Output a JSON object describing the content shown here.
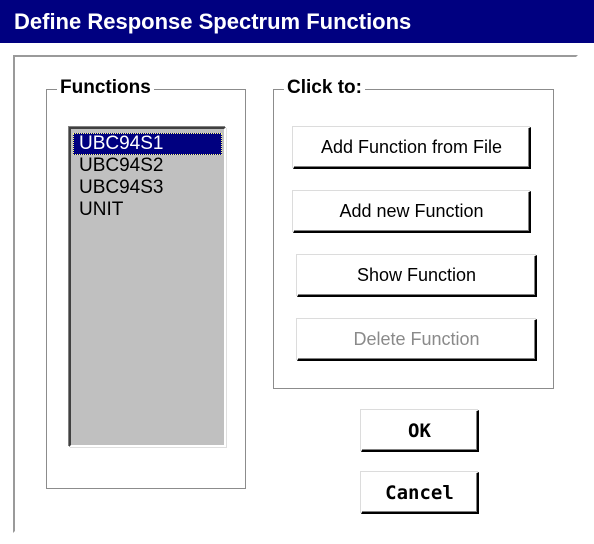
{
  "window": {
    "title": "Define Response Spectrum Functions"
  },
  "functions_group": {
    "label": "Functions",
    "items": [
      "UBC94S1",
      "UBC94S2",
      "UBC94S3",
      "UNIT"
    ],
    "selected_index": 0
  },
  "click_group": {
    "label": "Click to:",
    "add_from_file": "Add Function from File",
    "add_new": "Add new Function",
    "show": "Show Function",
    "delete": "Delete Function"
  },
  "dialog_buttons": {
    "ok": "OK",
    "cancel": "Cancel"
  },
  "colors": {
    "titlebar": "#000080",
    "selection": "#000080",
    "list_background": "#c0c0c0",
    "disabled_text": "#8a8a8a"
  }
}
